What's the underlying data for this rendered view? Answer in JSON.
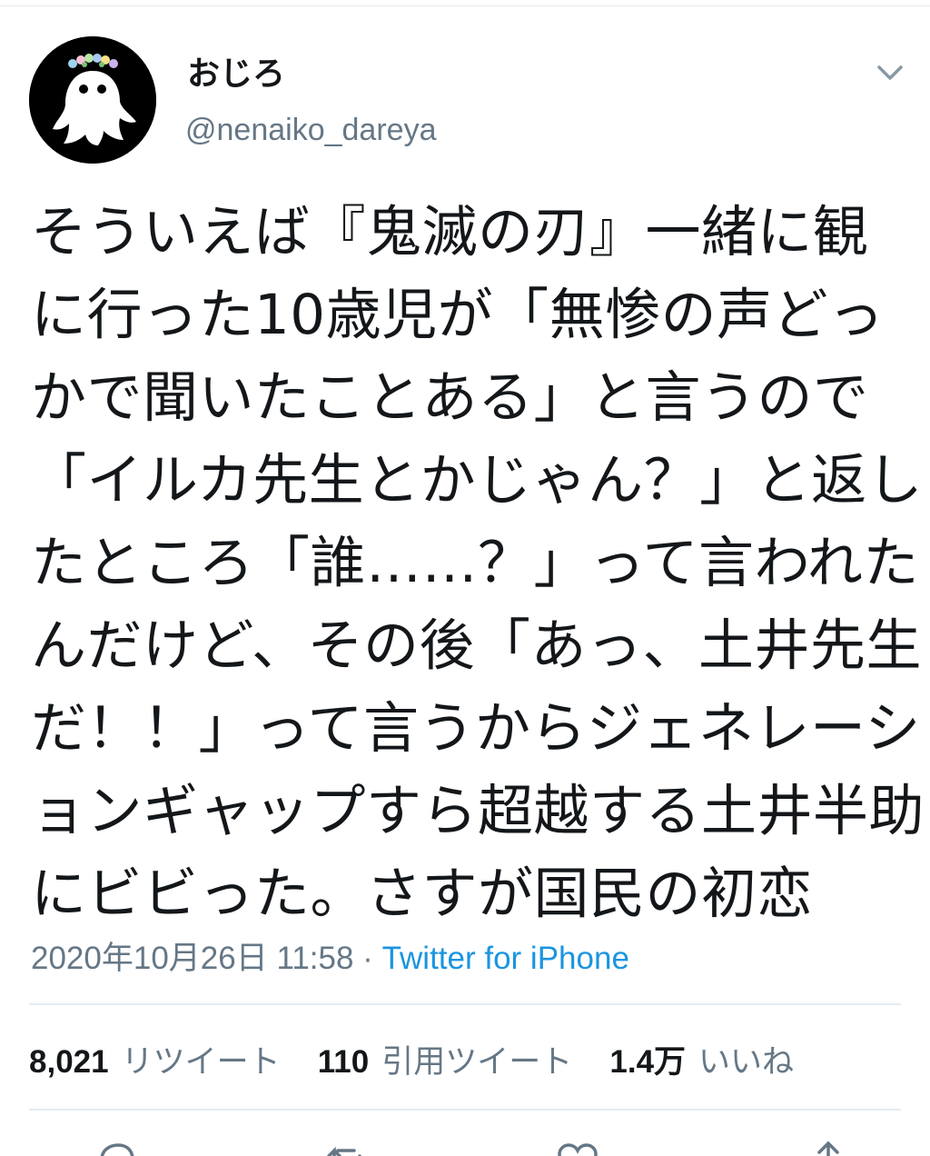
{
  "user": {
    "display_name": "おじろ",
    "handle": "@nenaiko_dareya"
  },
  "tweet": {
    "lines": [
      "そういえば『鬼滅の刃』一緒に観",
      "に行った10歳児が「無惨の声どっ",
      "かで聞いたことある」と言うので",
      "「イルカ先生とかじゃん？」と返し",
      "たところ「誰……？」って言われた",
      "んだけど、その後「あっ、土井先生",
      "だ！！」って言うからジェネレーシ",
      "ョンギャップすら超越する土井半助",
      "にビビった。さすが国民の初恋"
    ],
    "timestamp": "2020年10月26日 11:58",
    "separator": "·",
    "source": "Twitter for iPhone"
  },
  "stats": {
    "retweets_count": "8,021",
    "retweets_label": "リツイート",
    "quotes_count": "110",
    "quotes_label": "引用ツイート",
    "likes_count": "1.4万",
    "likes_label": "いいね"
  },
  "icons": {
    "menu": "chevron-down-icon",
    "reply": "reply-icon",
    "retweet": "retweet-icon",
    "like": "heart-icon",
    "share": "share-icon"
  }
}
